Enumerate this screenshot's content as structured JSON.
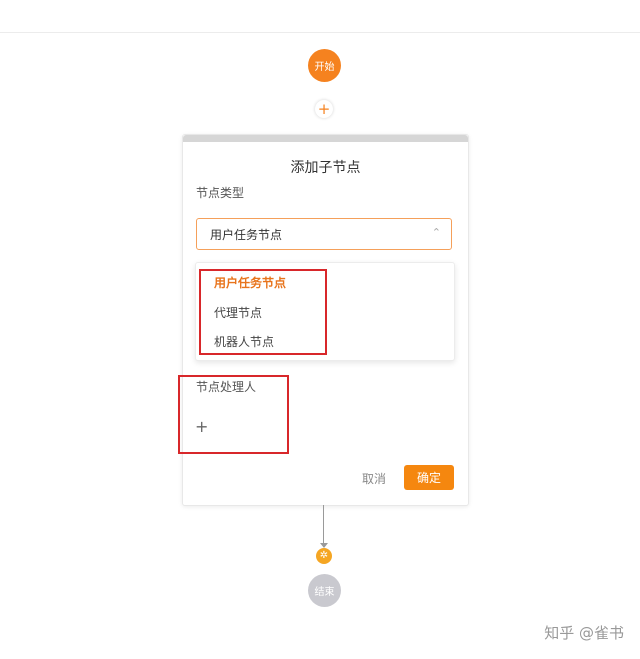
{
  "flow": {
    "start_label": "开始",
    "add_symbol": "+",
    "end_label": "结束",
    "merge_icon": "✲"
  },
  "panel": {
    "title": "添加子节点",
    "node_type_label": "节点类型",
    "selected_type": "用户任务节点",
    "chevron": "⌃",
    "handler_label": "节点处理人",
    "add_handler_symbol": "+",
    "cancel_label": "取消",
    "ok_label": "确定"
  },
  "dropdown": {
    "options": [
      "用户任务节点",
      "代理节点",
      "机器人节点"
    ]
  },
  "watermark": "知乎 @雀书",
  "colors": {
    "accent": "#f5821f",
    "selected_option": "#e8741c",
    "highlight_box": "#d8272a",
    "end_node": "#c9c9cf"
  }
}
